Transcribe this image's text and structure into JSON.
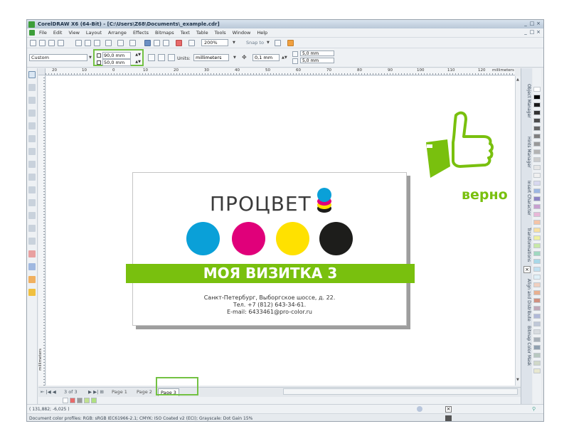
{
  "window": {
    "title": "CorelDRAW X6 (64-Bit) - [C:\\Users\\Z68\\Documents\\_example.cdr]",
    "controls": [
      "_",
      "□",
      "×"
    ]
  },
  "menu": [
    "File",
    "Edit",
    "View",
    "Layout",
    "Arrange",
    "Effects",
    "Bitmaps",
    "Text",
    "Table",
    "Tools",
    "Window",
    "Help"
  ],
  "standard_toolbar": {
    "zoom": "200%",
    "snap_to": "Snap to"
  },
  "property_bar": {
    "preset": "Custom",
    "width": "90,0 mm",
    "height": "50,0 mm",
    "units_label": "Units:",
    "units": "millimeters",
    "nudge": "0,1 mm",
    "dup_x": "5,0 mm",
    "dup_y": "5,0 mm"
  },
  "ruler": {
    "ticks": [
      "20",
      "10",
      "0",
      "10",
      "20",
      "30",
      "40",
      "50",
      "60",
      "70",
      "80",
      "90",
      "100",
      "110",
      "120"
    ],
    "unit": "millimeters",
    "vertical_unit": "millimeters"
  },
  "card": {
    "brand": "ПРОЦВЕТ",
    "banner": "МОЯ ВИЗИТКА 3",
    "address": "Санкт-Петербург, Выборгское шоссе, д. 22.",
    "phone": "Тел. +7 (812) 643-34-61.",
    "email": "E-mail: 6433461@pro-color.ru",
    "ink_colors": [
      "#0aa0d8",
      "#e0007a",
      "#ffe100",
      "#1d1d1b"
    ]
  },
  "annotation": {
    "verdict": "верно",
    "color": "#79c00e"
  },
  "page_nav": {
    "counter": "3 of 3",
    "tabs": [
      "Page 1",
      "Page 2",
      "Page 3"
    ],
    "active_tab": "Page 3"
  },
  "dockers": [
    "Object Manager",
    "Hints Manager",
    "Insert Character",
    "Transformations",
    "Align and Distribute",
    "Bitmap Color Mask"
  ],
  "status": {
    "coords": "( 131,882; -6,025 )",
    "color_profiles": "Document color profiles: RGB: sRGB IEC61966-2.1; CMYK: ISO Coated v2 (ECI); Grayscale: Dot Gain 15%"
  },
  "palette_colors": [
    "#ffffff",
    "#000000",
    "#1a1a1a",
    "#333333",
    "#4d4d4d",
    "#666666",
    "#808080",
    "#999999",
    "#b3b3b3",
    "#cccccc",
    "#e6e6e6",
    "#f0f0f0",
    "#d8d8ef",
    "#9db7e2",
    "#8c84c4",
    "#c8a0d0",
    "#e8b8d8",
    "#f4c4a8",
    "#f8e0a0",
    "#eef0a0",
    "#c8e8a8",
    "#a0d8c0",
    "#a8d8e8",
    "#c0e0f0",
    "#e0f0f8",
    "#f0d0c0",
    "#e8b090",
    "#d09080",
    "#c0a8b8",
    "#b0b8d8",
    "#c0c8d8",
    "#d8dce0",
    "#a8b0b8",
    "#90a0b0",
    "#b8c8c0",
    "#d0d8c8",
    "#e8e8d0"
  ],
  "doc_palette": [
    "#ffffff",
    "#e86a6a",
    "#9a9a9a",
    "#c0e090",
    "#b0e080"
  ]
}
